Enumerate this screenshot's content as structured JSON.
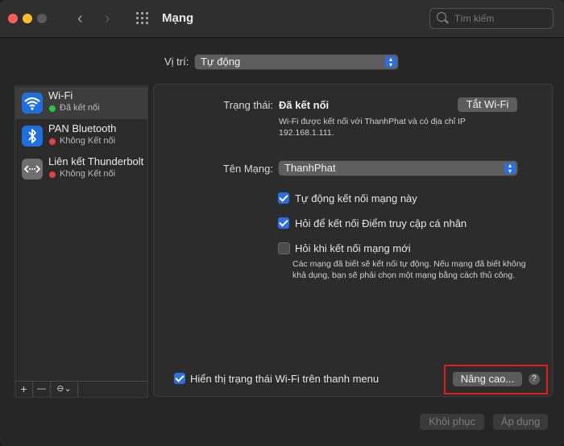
{
  "window": {
    "title": "Mạng",
    "search_placeholder": "Tìm kiếm"
  },
  "location": {
    "label": "Vị trí:",
    "value": "Tự động"
  },
  "services": [
    {
      "name": "Wi-Fi",
      "status": "Đã kết nối",
      "status_color": "#27c93f",
      "icon": "wifi-icon",
      "selected": true
    },
    {
      "name": "PAN Bluetooth",
      "status": "Không Kết nối",
      "status_color": "#e0443e",
      "icon": "bluetooth-icon",
      "selected": false
    },
    {
      "name": "Liên kết Thunderbolt",
      "status": "Không Kết nối",
      "status_color": "#e0443e",
      "icon": "thunderbolt-bridge-icon",
      "selected": false
    }
  ],
  "sidebar_toolbar": {
    "add": "+",
    "remove": "—",
    "action": "⊖⌄"
  },
  "detail": {
    "status_label": "Trạng thái:",
    "status_value": "Đã kết nối",
    "turn_off_button": "Tắt Wi-Fi",
    "status_desc": "Wi-Fi được kết nối với ThanhPhat và có địa chỉ IP 192.168.1.111.",
    "network_label": "Tên Mạng:",
    "network_value": "ThanhPhat",
    "options": [
      {
        "label": "Tự động kết nối mạng này",
        "checked": true
      },
      {
        "label": "Hỏi để kết nối Điểm truy cập cá nhân",
        "checked": true
      },
      {
        "label": "Hỏi khi kết nối mạng mới",
        "checked": false
      }
    ],
    "ask_desc": "Các mạng đã biết sẽ kết nối tự động. Nếu mạng đã biết không khả dụng, bạn sẽ phải chọn một mạng bằng cách thủ công.",
    "show_menu_label": "Hiển thị trạng thái Wi-Fi trên thanh menu",
    "show_menu_checked": true,
    "advanced_button": "Nâng cao...",
    "help": "?"
  },
  "footer": {
    "revert": "Khôi phục",
    "apply": "Áp dụng"
  },
  "colors": {
    "accent": "#2d6fe0",
    "highlight": "#e01b1b"
  }
}
